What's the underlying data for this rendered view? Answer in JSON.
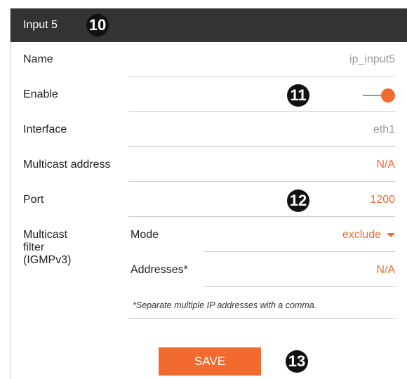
{
  "header": {
    "title": "Input 5"
  },
  "callouts": {
    "c10": "10",
    "c11": "11",
    "c12": "12",
    "c13": "13"
  },
  "rows": {
    "name": {
      "label": "Name",
      "value": "ip_input5"
    },
    "enable": {
      "label": "Enable",
      "value": true
    },
    "interface": {
      "label": "Interface",
      "value": "eth1"
    },
    "multicast_address": {
      "label": "Multicast address",
      "value": "N/A"
    },
    "port": {
      "label": "Port",
      "value": "1200"
    },
    "multicast_filter": {
      "label_line1": "Multicast",
      "label_line2": "filter",
      "label_line3": "(IGMPv3)",
      "mode_label": "Mode",
      "mode_value": "exclude",
      "addresses_label": "Addresses*",
      "addresses_value": "N/A",
      "note": "*Separate multiple IP addresses with a comma."
    }
  },
  "actions": {
    "save_label": "SAVE"
  },
  "colors": {
    "accent": "#f26a2e",
    "header_bg": "#333333",
    "muted": "#9a9a9a"
  }
}
